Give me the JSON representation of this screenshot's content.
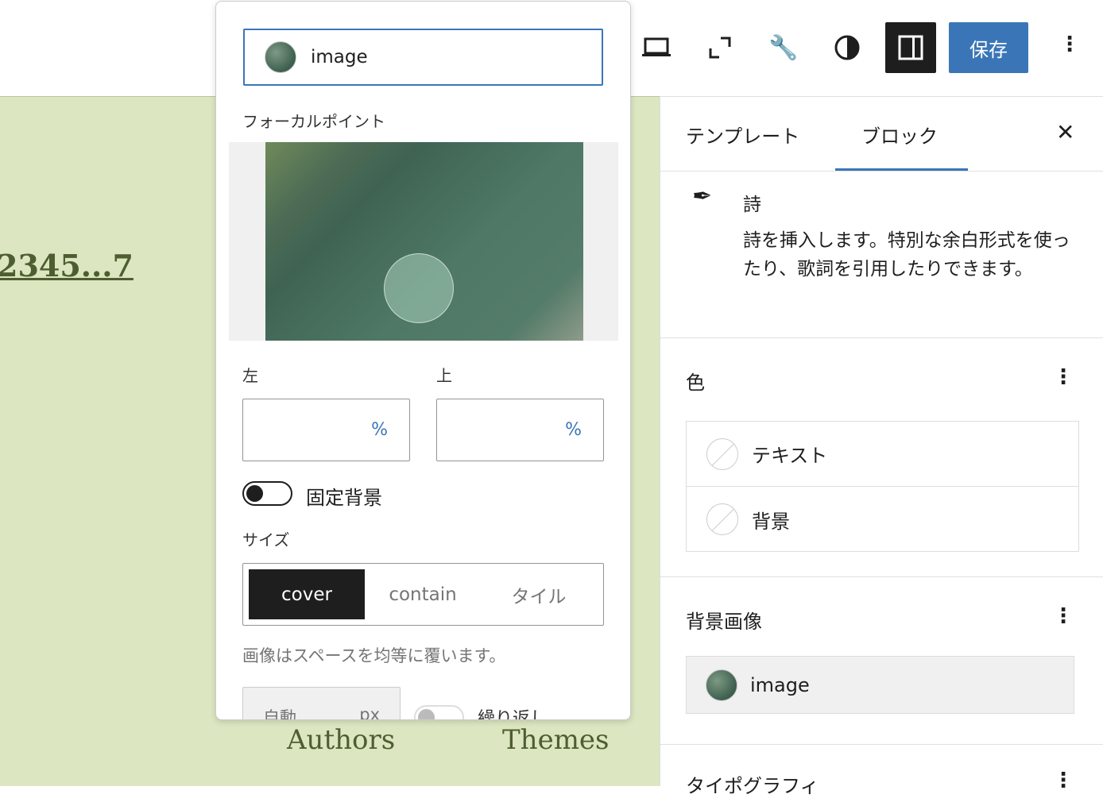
{
  "canvas": {
    "pagination": "2345...7",
    "footer_links": [
      "Authors",
      "Themes"
    ]
  },
  "toolbar": {
    "save_label": "保存",
    "icons": [
      "laptop-icon",
      "fullscreen-icon",
      "wrench-icon",
      "contrast-icon",
      "sidebar-toggle-icon",
      "more-vertical-icon"
    ]
  },
  "sidebar": {
    "tabs": [
      {
        "label": "テンプレート"
      },
      {
        "label": "ブロック",
        "active": true
      }
    ],
    "block": {
      "title": "詩",
      "description": "詩を挿入します。特別な余白形式を使ったり、歌詞を引用したりできます。"
    },
    "color": {
      "heading": "色",
      "items": [
        "テキスト",
        "背景"
      ]
    },
    "background_image": {
      "heading": "背景画像",
      "image_label": "image"
    },
    "typography": {
      "heading": "タイポグラフィ"
    }
  },
  "popover": {
    "image_label": "image",
    "focal_point_label": "フォーカルポイント",
    "left_label": "左",
    "top_label": "上",
    "unit": "%",
    "left_value": "",
    "top_value": "",
    "fixed_bg_label": "固定背景",
    "fixed_bg_on": false,
    "size_label": "サイズ",
    "size_options": [
      "cover",
      "contain",
      "タイル"
    ],
    "size_selected": "cover",
    "help": "画像はスペースを均等に覆います。",
    "width_placeholder": "自動",
    "width_unit": "px",
    "repeat_label": "繰り返し",
    "repeat_on": false
  },
  "colors": {
    "accent": "#3a76b7",
    "dark": "#1e1e1e",
    "canvas": "#dce6c1"
  }
}
